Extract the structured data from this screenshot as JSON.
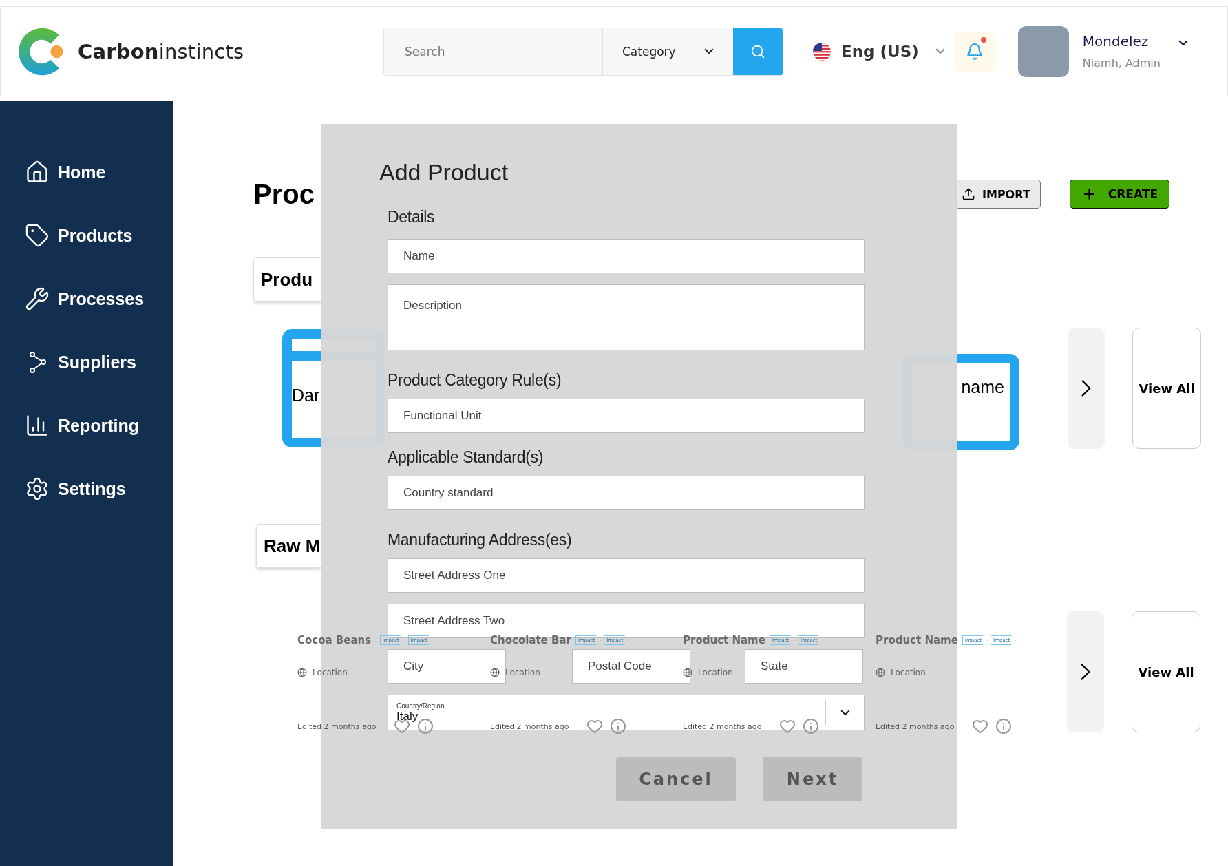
{
  "header": {
    "logo_text": "**Carbon**instincts",
    "search": {
      "placeholder": "Search"
    },
    "category": "Category",
    "language": "Eng (US)",
    "notification": {
      "unread": true
    },
    "user": {
      "name": "Mondelez",
      "role": "Niamh, Admin"
    }
  },
  "sidebar": {
    "items": [
      {
        "label": "Home"
      },
      {
        "label": "Products"
      },
      {
        "label": "Processes"
      },
      {
        "label": "Suppliers"
      },
      {
        "label": "Reporting"
      },
      {
        "label": "Settings"
      }
    ]
  },
  "page": {
    "title": "Proc",
    "import_button": "IMPORT",
    "create_button": "CREATE",
    "products_section": {
      "tab": "Produ",
      "left_card": "Dar",
      "right_card": "name",
      "view_all": "View All"
    },
    "raw_section": {
      "tab": "Raw M",
      "view_all": "View All",
      "cards": [
        {
          "title": "Cocoa Beans",
          "location": "Location",
          "edited": "Edited 2 months ago",
          "tags": [
            "Impact",
            "Impact"
          ]
        },
        {
          "title": "Chocolate Bar",
          "location": "Location",
          "edited": "Edited 2 months ago",
          "tags": [
            "Impact",
            "Impact"
          ]
        },
        {
          "title": "Product Name",
          "location": "Location",
          "edited": "Edited 2 months ago",
          "tags": [
            "Impact",
            "Impact"
          ]
        },
        {
          "title": "Product Name",
          "location": "Location",
          "edited": "Edited 2 months ago",
          "tags": [
            "Impact",
            "Impact"
          ]
        }
      ]
    }
  },
  "modal": {
    "title": "Add Product",
    "sections": [
      {
        "heading": "Details",
        "rows": [
          [
            {
              "kind": "text",
              "placeholder": "Name"
            }
          ],
          [
            {
              "kind": "textarea",
              "placeholder": "Description"
            }
          ]
        ]
      },
      {
        "heading": "Product Category Rule(s)",
        "rows": [
          [
            {
              "kind": "text",
              "placeholder": "Functional Unit"
            }
          ]
        ]
      },
      {
        "heading": "Applicable Standard(s)",
        "rows": [
          [
            {
              "kind": "text",
              "placeholder": "Country standard"
            }
          ]
        ]
      },
      {
        "heading": "Manufacturing Address(es)",
        "rows": [
          [
            {
              "kind": "text",
              "placeholder": "Street Address One"
            }
          ],
          [
            {
              "kind": "text",
              "placeholder": "Street Address Two"
            }
          ],
          [
            {
              "kind": "text",
              "placeholder": "City"
            },
            {
              "kind": "text",
              "placeholder": "Postal Code"
            },
            {
              "kind": "text",
              "placeholder": "State"
            }
          ],
          [
            {
              "kind": "select",
              "label": "Country/Region",
              "value": "Italy"
            }
          ]
        ]
      }
    ],
    "buttons": [
      {
        "label": "Cancel"
      },
      {
        "label": "Next"
      }
    ]
  }
}
